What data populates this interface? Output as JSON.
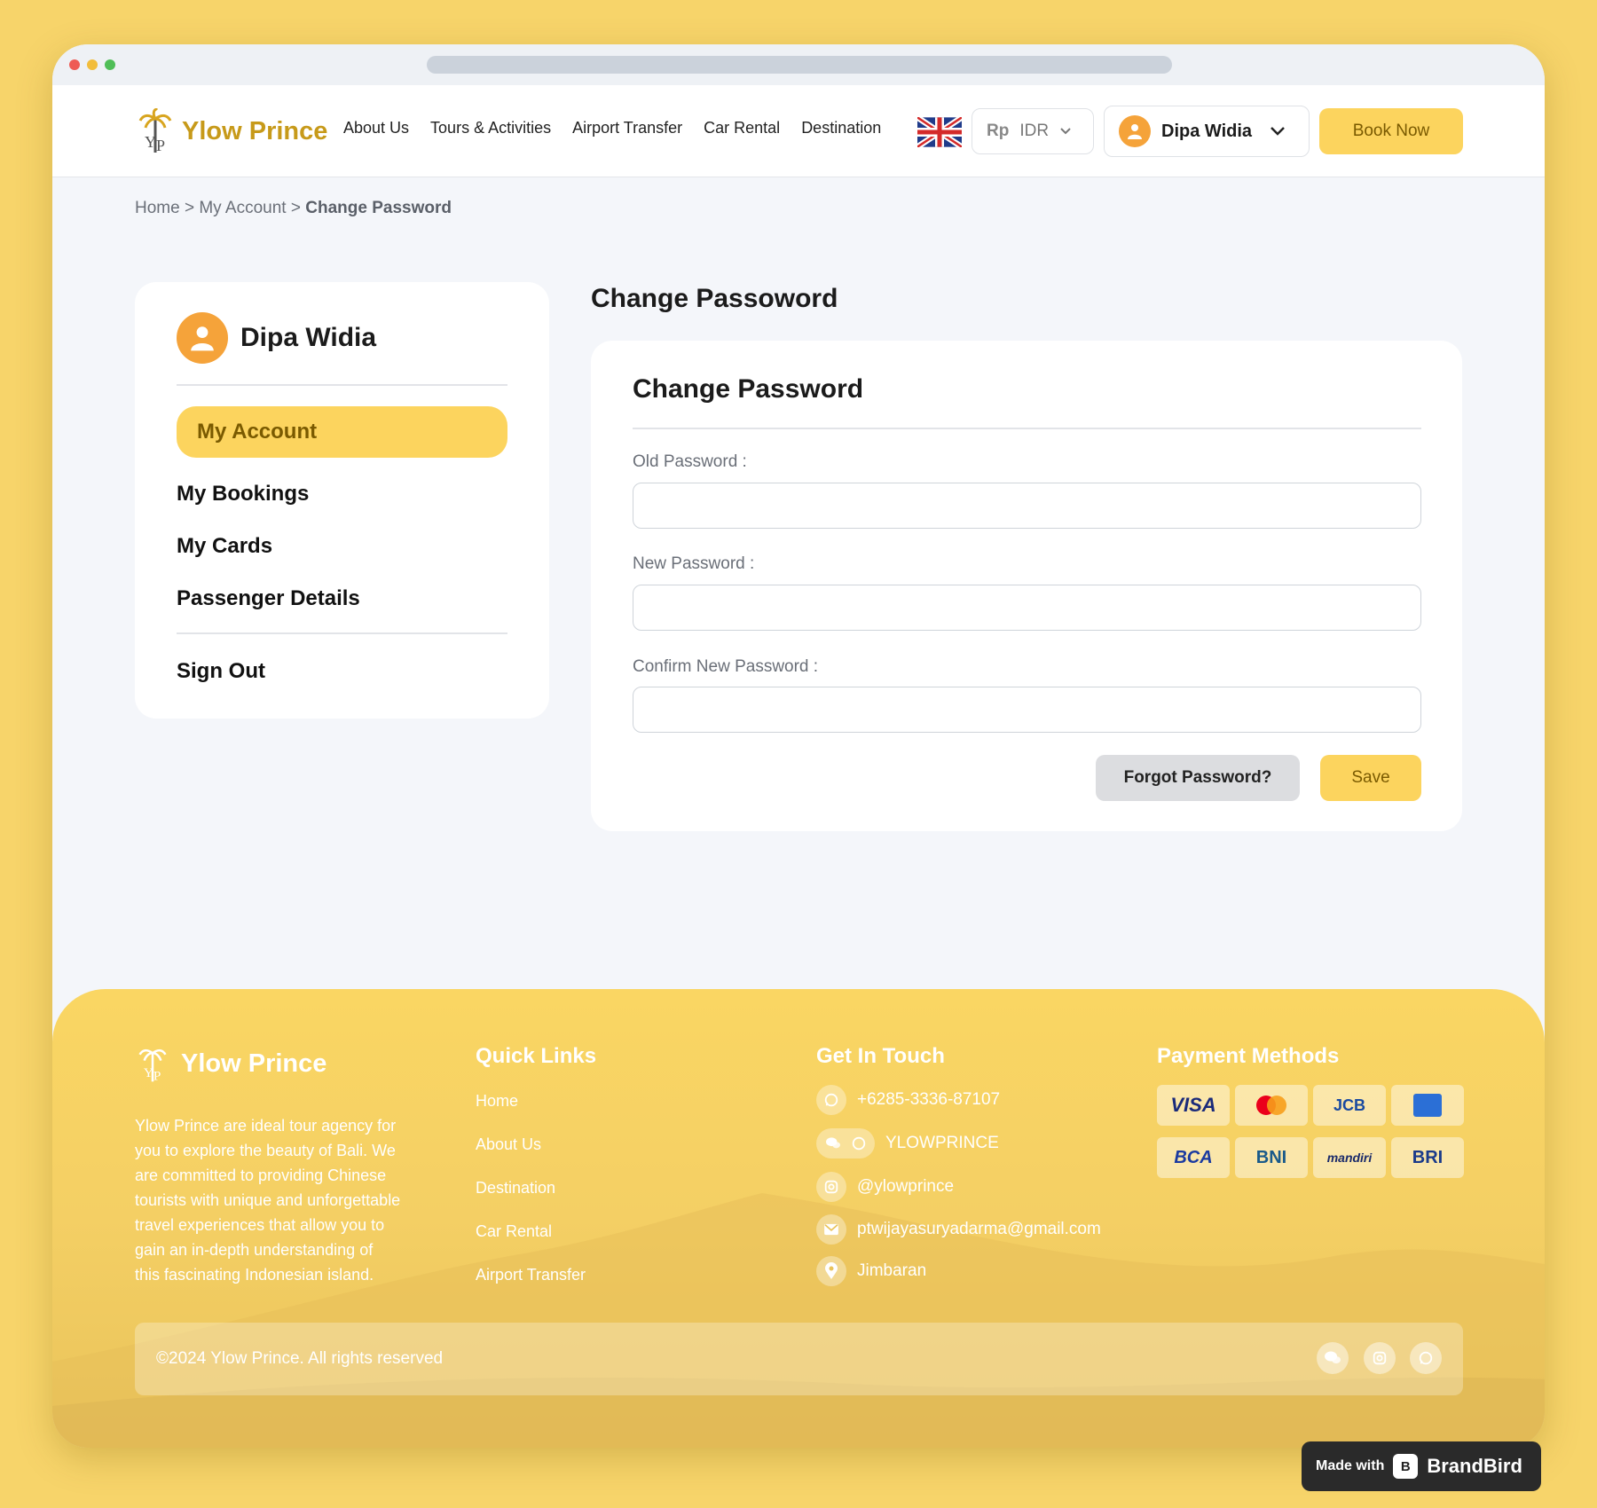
{
  "brand": {
    "name": "Ylow Prince",
    "accent": "#fcd45e",
    "orange": "#f5a33a"
  },
  "nav": {
    "links": [
      "About Us",
      "Tours & Activities",
      "Airport Transfer",
      "Car Rental",
      "Destination"
    ],
    "currency_symbol": "Rp",
    "currency_code": "IDR",
    "user_name": "Dipa Widia",
    "book_label": "Book Now"
  },
  "breadcrumb": {
    "home": "Home",
    "account": "My Account",
    "current": "Change Password",
    "sep": ">"
  },
  "sidebar": {
    "user_name": "Dipa Widia",
    "active": "My Account",
    "items": [
      "My Bookings",
      "My Cards",
      "Passenger Details"
    ],
    "signout": "Sign Out"
  },
  "main": {
    "page_title": "Change Passoword",
    "card_title": "Change Password",
    "fields": [
      {
        "label": "Old Password :",
        "value": ""
      },
      {
        "label": "New Password :",
        "value": ""
      },
      {
        "label": "Confirm New Password :",
        "value": ""
      }
    ],
    "forgot_label": "Forgot Password?",
    "save_label": "Save"
  },
  "footer": {
    "brand": "Ylow Prince",
    "description": "Ylow Prince are ideal tour agency for you to explore the beauty of Bali. We are committed to providing Chinese tourists with unique and unforgettable travel experiences that allow you to gain an in-depth understanding of this fascinating Indonesian island.",
    "quick_links_title": "Quick Links",
    "quick_links": [
      "Home",
      "About Us",
      "Destination",
      "Car Rental",
      "Airport Transfer"
    ],
    "contact_title": "Get In Touch",
    "contacts": [
      {
        "icon": "whatsapp-icon",
        "text": "+6285-3336-87107"
      },
      {
        "icon": "wechat-whatsapp-icon",
        "text": "YLOWPRINCE"
      },
      {
        "icon": "instagram-icon",
        "text": "@ylowprince"
      },
      {
        "icon": "email-icon",
        "text": "ptwijayasuryadarma@gmail.com"
      },
      {
        "icon": "location-icon",
        "text": "Jimbaran"
      }
    ],
    "payment_title": "Payment Methods",
    "payments": [
      "VISA",
      "mastercard",
      "JCB",
      "AMEX",
      "BCA",
      "BNI",
      "mandiri",
      "BRI"
    ],
    "copyright": "©2024 Ylow Prince. All rights reserved"
  },
  "badge": {
    "made_with": "Made with",
    "brand": "BrandBird"
  }
}
